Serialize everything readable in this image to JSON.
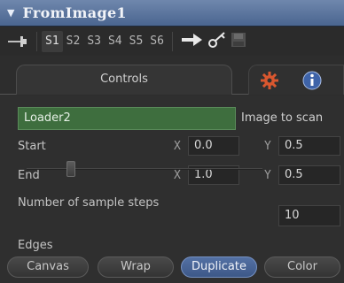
{
  "header": {
    "title": "FromImage1"
  },
  "toolbar": {
    "slots": [
      "S1",
      "S2",
      "S3",
      "S4",
      "S5",
      "S6"
    ],
    "active_slot": "S1"
  },
  "tabs": {
    "controls_label": "Controls",
    "gear_icon": "gear-icon",
    "info_icon": "info-icon"
  },
  "loader": {
    "value": "Loader2",
    "label": "Image to scan",
    "color": "#3e6e3e"
  },
  "start": {
    "label": "Start",
    "x_label": "X",
    "x_value": "0.0",
    "y_label": "Y",
    "y_value": "0.5"
  },
  "end": {
    "label": "End",
    "x_label": "X",
    "x_value": "1.0",
    "y_label": "Y",
    "y_value": "0.5"
  },
  "sample_steps": {
    "label": "Number of sample steps",
    "value": "10"
  },
  "edges": {
    "label": "Edges",
    "options": [
      "Canvas",
      "Wrap",
      "Duplicate",
      "Color"
    ],
    "selected": "Duplicate"
  }
}
